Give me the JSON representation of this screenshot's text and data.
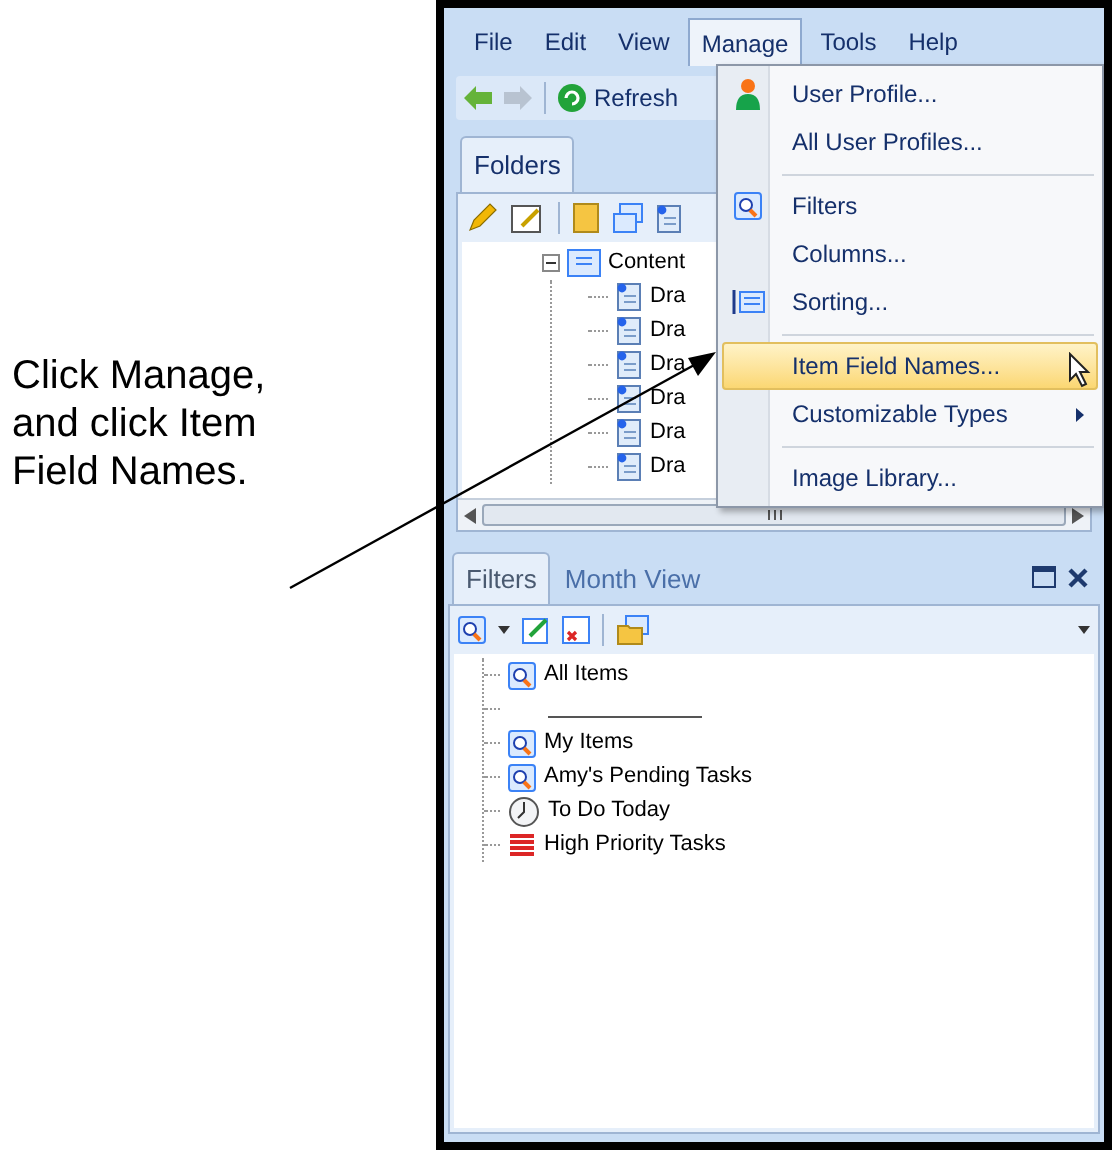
{
  "callout": {
    "text": "Click Manage, and click Item Field Names."
  },
  "menu_bar": [
    {
      "label": "File",
      "selected": false
    },
    {
      "label": "Edit",
      "selected": false
    },
    {
      "label": "View",
      "selected": false
    },
    {
      "label": "Manage",
      "selected": true
    },
    {
      "label": "Tools",
      "selected": false
    },
    {
      "label": "Help",
      "selected": false
    }
  ],
  "toolbar": {
    "refresh": "Refresh"
  },
  "folders_panel": {
    "tabs": [
      {
        "label": "Folders",
        "selected": true
      }
    ],
    "tree": [
      {
        "label": "Content",
        "expanded": true,
        "children": [
          {
            "label": "Dra"
          },
          {
            "label": "Dra"
          },
          {
            "label": "Dra"
          },
          {
            "label": "Dra"
          },
          {
            "label": "Dra"
          },
          {
            "label": "Dra"
          }
        ]
      }
    ]
  },
  "manage_menu": [
    {
      "kind": "item",
      "label": "User Profile...",
      "selected": false
    },
    {
      "kind": "item",
      "label": "All User Profiles...",
      "selected": false
    },
    {
      "kind": "separator"
    },
    {
      "kind": "item",
      "label": "Filters",
      "selected": false
    },
    {
      "kind": "item",
      "label": "Columns...",
      "selected": false
    },
    {
      "kind": "item",
      "label": "Sorting...",
      "selected": false
    },
    {
      "kind": "separator"
    },
    {
      "kind": "item",
      "label": "Item Field Names...",
      "selected": true
    },
    {
      "kind": "submenu",
      "label": "Customizable Types",
      "selected": false
    },
    {
      "kind": "separator"
    },
    {
      "kind": "item",
      "label": "Image Library...",
      "selected": false
    }
  ],
  "filters_panel": {
    "tabs": [
      {
        "label": "Filters",
        "selected": true
      },
      {
        "label": "Month View",
        "selected": false
      }
    ],
    "items": [
      {
        "kind": "filter",
        "label": "All Items"
      },
      {
        "kind": "separator"
      },
      {
        "kind": "filter",
        "label": "My Items"
      },
      {
        "kind": "filter",
        "label": "Amy's Pending Tasks"
      },
      {
        "kind": "clock",
        "label": "To Do Today"
      },
      {
        "kind": "priority",
        "label": "High Priority Tasks"
      }
    ]
  }
}
